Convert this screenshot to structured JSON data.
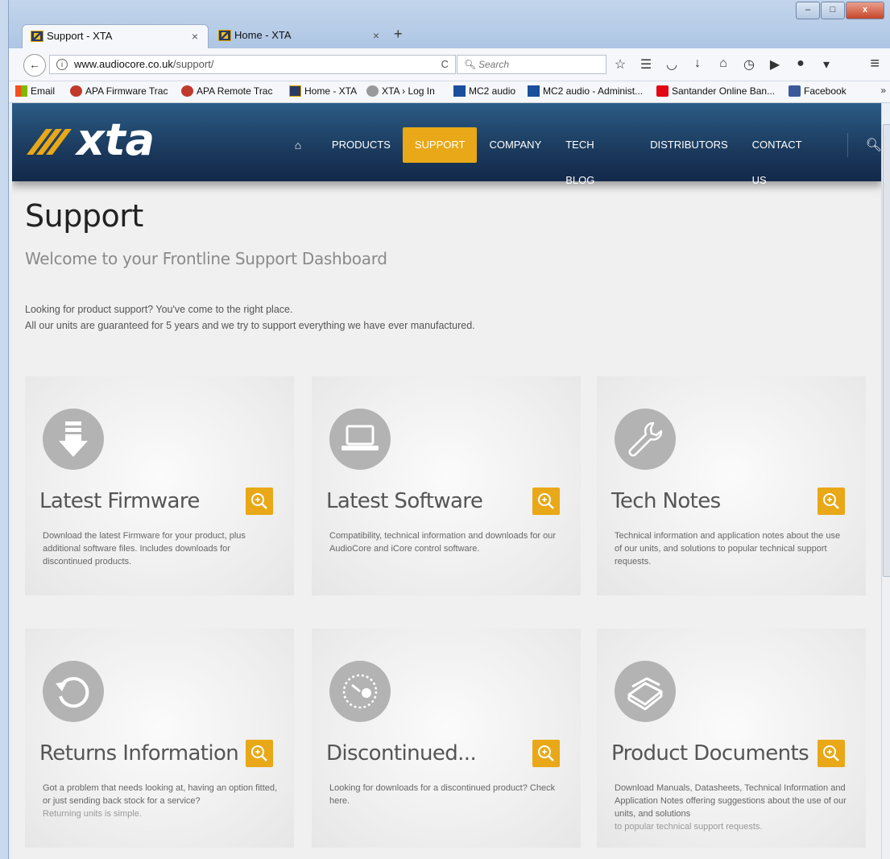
{
  "browser": {
    "tabs": [
      {
        "title": "Support - XTA",
        "active": true
      },
      {
        "title": "Home - XTA",
        "active": false
      }
    ],
    "new_tab": "+",
    "close_glyph": "×",
    "window_buttons": {
      "minimize": "–",
      "maximize": "□",
      "close": "x"
    },
    "url": {
      "domain": "www.audiocore.co.uk",
      "path": "/support/"
    },
    "search_placeholder": "Search",
    "bookmarks": [
      {
        "label": "Email",
        "icon": "windows-icon"
      },
      {
        "label": "APA Firmware Trac",
        "icon": "trac-icon"
      },
      {
        "label": "APA Remote Trac",
        "icon": "trac-icon"
      },
      {
        "label": "Home - XTA",
        "icon": "xta-icon"
      },
      {
        "label": "XTA › Log In",
        "icon": "globe-icon"
      },
      {
        "label": "MC2 audio",
        "icon": "mc2-icon"
      },
      {
        "label": "MC2 audio - Administ...",
        "icon": "mc2-icon"
      },
      {
        "label": "Santander Online Ban...",
        "icon": "santander-icon"
      },
      {
        "label": "Facebook",
        "icon": "facebook-icon"
      }
    ],
    "bookmarks_more": "»"
  },
  "site": {
    "brand": "xta",
    "nav": [
      "PRODUCTS",
      "SUPPORT",
      "COMPANY",
      "TECH BLOG",
      "DISTRIBUTORS",
      "CONTACT US"
    ],
    "active_nav": "SUPPORT"
  },
  "page": {
    "title": "Support",
    "subtitle": "Welcome to your Frontline Support Dashboard",
    "intro_line1": "Looking for product support? You've come to the right place.",
    "intro_line2": "All our units are guaranteed for 5 years and we try to support everything we have ever manufactured."
  },
  "cards": [
    {
      "title": "Latest Firmware",
      "icon": "download-icon",
      "desc": "Download the latest Firmware for your product, plus additional software files. Includes downloads for discontinued products.",
      "desc_extra": ""
    },
    {
      "title": "Latest Software",
      "icon": "laptop-icon",
      "desc": "Compatibility, technical information and downloads for our AudioCore and iCore control software.",
      "desc_extra": ""
    },
    {
      "title": "Tech Notes",
      "icon": "wrench-icon",
      "desc": "Technical information and application notes about the use of our units, and solutions to popular technical support requests.",
      "desc_extra": ""
    },
    {
      "title": "Returns Information",
      "icon": "return-icon",
      "desc": "Got a problem that needs looking at, having an option fitted, or just sending back stock for a service?",
      "desc_extra": "Returning units is simple."
    },
    {
      "title": "Discontinued...",
      "icon": "gauge-icon",
      "desc": "Looking for downloads for a discontinued product? Check here.",
      "desc_extra": ""
    },
    {
      "title": "Product Documents",
      "icon": "books-icon",
      "desc": "Download Manuals, Datasheets, Technical Information and Application Notes offering suggestions about the use of our units, and solutions",
      "desc_extra": "to popular technical support requests."
    }
  ],
  "colors": {
    "accent": "#e8a817",
    "header": "#1b3a5d",
    "icon_circle": "#b3b3b3"
  }
}
